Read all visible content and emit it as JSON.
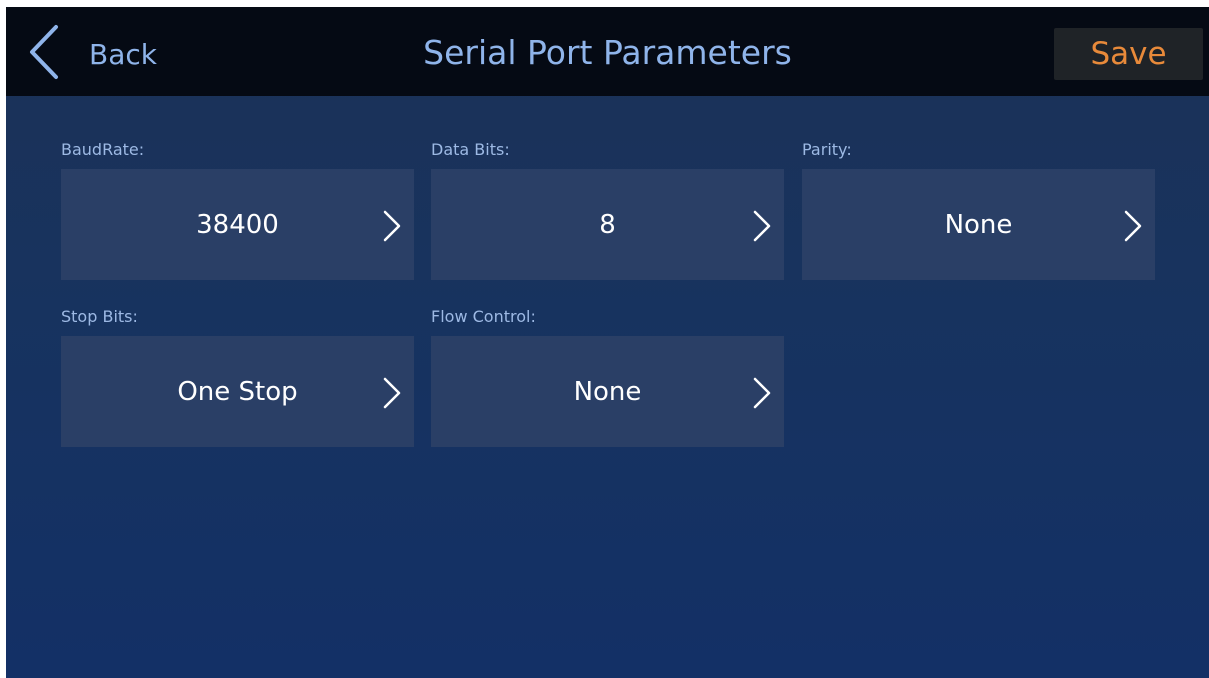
{
  "header": {
    "back_label": "Back",
    "title": "Serial Port Parameters",
    "save_label": "Save"
  },
  "fields": {
    "baud_rate": {
      "label": "BaudRate:",
      "value": "38400"
    },
    "data_bits": {
      "label": "Data Bits:",
      "value": "8"
    },
    "parity": {
      "label": "Parity:",
      "value": "None"
    },
    "stop_bits": {
      "label": "Stop Bits:",
      "value": "One Stop"
    },
    "flow_control": {
      "label": "Flow Control:",
      "value": "None"
    }
  },
  "icons": {
    "back": "chevron-left-icon",
    "field_arrow": "chevron-right-icon"
  },
  "colors": {
    "accent_text": "#8fb4ea",
    "save_text": "#e88a3a",
    "topbar": "#050a14",
    "field_box": "#2a3f66"
  }
}
